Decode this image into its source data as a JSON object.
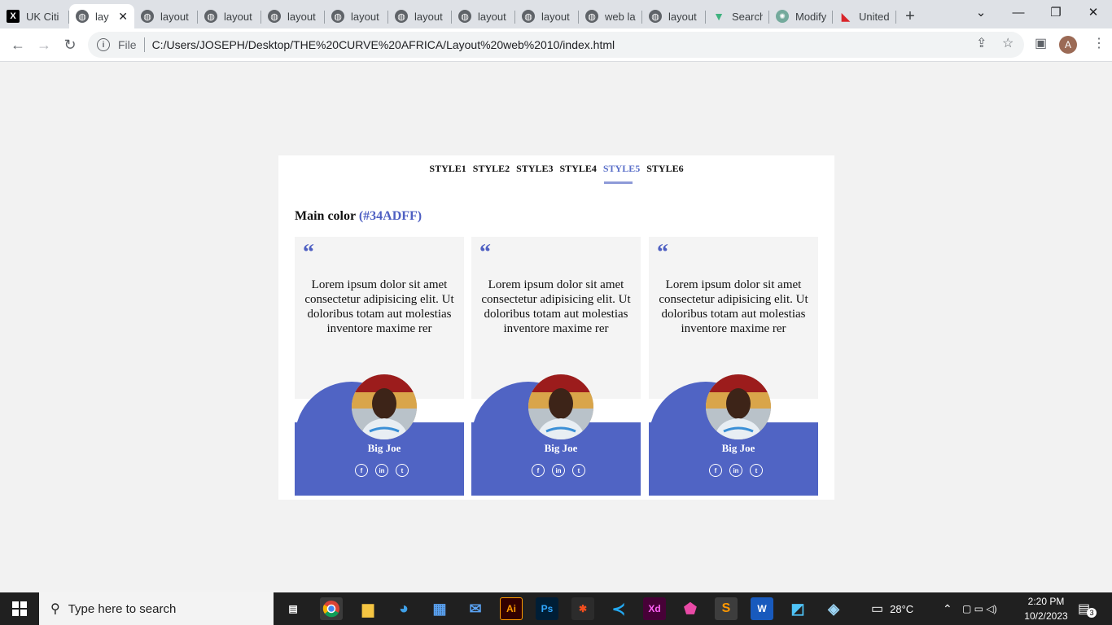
{
  "browser": {
    "tabs": [
      {
        "label": "UK Citi",
        "icon": "x-logo-icon"
      },
      {
        "label": "lay",
        "icon": "globe-icon",
        "active": true
      },
      {
        "label": "layout",
        "icon": "globe-icon"
      },
      {
        "label": "layout",
        "icon": "globe-icon"
      },
      {
        "label": "layout",
        "icon": "globe-icon"
      },
      {
        "label": "layout",
        "icon": "globe-icon"
      },
      {
        "label": "layout",
        "icon": "globe-icon"
      },
      {
        "label": "layout",
        "icon": "globe-icon"
      },
      {
        "label": "layout",
        "icon": "globe-icon"
      },
      {
        "label": "web lay",
        "icon": "globe-icon"
      },
      {
        "label": "layout",
        "icon": "globe-icon"
      },
      {
        "label": "Search",
        "icon": "vue-icon"
      },
      {
        "label": "Modify",
        "icon": "chatgpt-icon"
      },
      {
        "label": "United",
        "icon": "unsplash-icon"
      }
    ],
    "new_tab": "+",
    "address": {
      "scheme_label": "File",
      "url": "C:/Users/JOSEPH/Desktop/THE%20CURVE%20AFRICA/Layout%20web%2010/index.html"
    },
    "profile_initial": "A"
  },
  "page": {
    "styles_nav": [
      "STYLE1",
      "STYLE2",
      "STYLE3",
      "STYLE4",
      "STYLE5",
      "STYLE6"
    ],
    "active_style": "STYLE5",
    "heading_prefix": "Main color",
    "heading_accent": "(#34ADFF)",
    "accent_color": "#4e5fc2",
    "cards": [
      {
        "quote_mark": "“",
        "text": "Lorem ipsum dolor sit amet consectetur adipisicing elit. Ut doloribus totam aut molestias inventore maxime rer",
        "name": "Big Joe",
        "socials": [
          "f",
          "in",
          "t"
        ]
      },
      {
        "quote_mark": "“",
        "text": "Lorem ipsum dolor sit amet consectetur adipisicing elit. Ut doloribus totam aut molestias inventore maxime rer",
        "name": "Big Joe",
        "socials": [
          "f",
          "in",
          "t"
        ]
      },
      {
        "quote_mark": "“",
        "text": "Lorem ipsum dolor sit amet consectetur adipisicing elit. Ut doloribus totam aut molestias inventore maxime rer",
        "name": "Big Joe",
        "socials": [
          "f",
          "in",
          "t"
        ]
      }
    ]
  },
  "taskbar": {
    "search_placeholder": "Type here to search",
    "apps": [
      "Ai",
      "Ps",
      "Xd",
      "W"
    ],
    "temperature": "28°C",
    "time": "2:20 PM",
    "date": "10/2/2023",
    "notifications": "3"
  }
}
